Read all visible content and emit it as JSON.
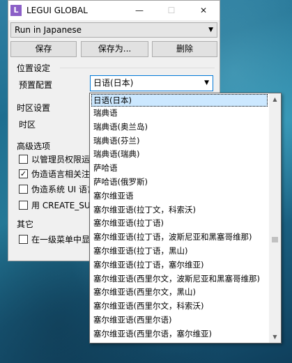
{
  "window": {
    "app_icon_letter": "L",
    "title": "LEGUI GLOBAL",
    "minimize_glyph": "—",
    "maximize_glyph": "☐",
    "close_glyph": "✕"
  },
  "profile_select": {
    "value": "Run in Japanese",
    "arrow": "▼"
  },
  "toolbar": {
    "save_label": "保存",
    "save_as_label": "保存为...",
    "delete_label": "删除"
  },
  "location_group": {
    "title": "位置设定",
    "preset_label": "预置配置",
    "preset_value": "日语(日本)",
    "arrow": "▼"
  },
  "timezone_group": {
    "title": "时区设置",
    "timezone_label": "时区"
  },
  "advanced_group": {
    "title": "高级选项",
    "options": [
      {
        "label": "以管理员权限运",
        "check": ""
      },
      {
        "label": "伪造语言相关注",
        "check": "✓"
      },
      {
        "label": "伪造系统 UI 语言",
        "check": ""
      },
      {
        "label": "用 CREATE_SUSP",
        "check": ""
      }
    ]
  },
  "other_group": {
    "title": "其它",
    "options": [
      {
        "label": "在一级菜单中显",
        "check": ""
      }
    ]
  },
  "dropdown": {
    "items": [
      "日语(日本)",
      "瑞典语",
      "瑞典语(奥兰岛)",
      "瑞典语(芬兰)",
      "瑞典语(瑞典)",
      "萨哈语",
      "萨哈语(俄罗斯)",
      "塞尔维亚语",
      "塞尔维亚语(拉丁文，科索沃)",
      "塞尔维亚语(拉丁语)",
      "塞尔维亚语(拉丁语，波斯尼亚和黑塞哥维那)",
      "塞尔维亚语(拉丁语，黑山)",
      "塞尔维亚语(拉丁语，塞尔维亚)",
      "塞尔维亚语(西里尔文，波斯尼亚和黑塞哥维那)",
      "塞尔维亚语(西里尔文，黑山)",
      "塞尔维亚语(西里尔文，科索沃)",
      "塞尔维亚语(西里尔语)",
      "塞尔维亚语(西里尔语，塞尔维亚)"
    ],
    "scroll_up": "▲",
    "scroll_down": "▼"
  }
}
